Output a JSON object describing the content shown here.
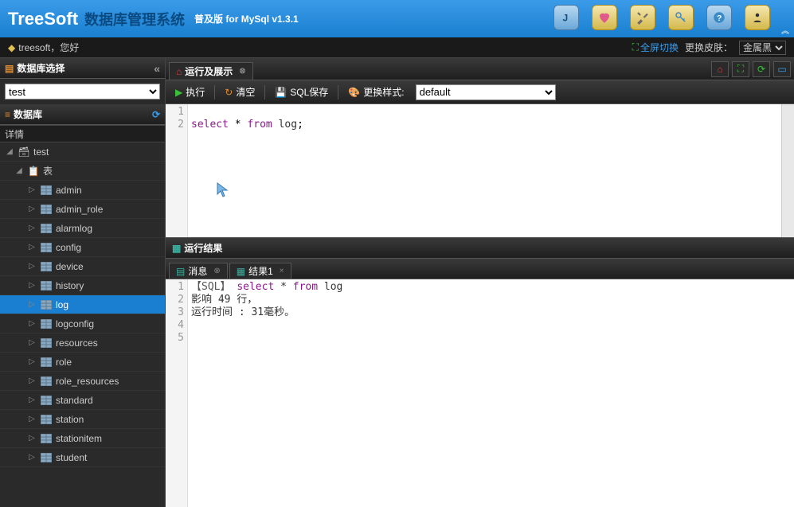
{
  "header": {
    "brand": "TreeSoft",
    "title": "数据库管理系统",
    "version": "普及版 for MySql v1.3.1"
  },
  "subheader": {
    "greeting": "treesoft，您好",
    "fullscreen": "全屏切换",
    "skin_label": "更换皮肤：",
    "skin_value": "金属黑"
  },
  "sidebar": {
    "select_panel": "数据库选择",
    "db_value": "test",
    "db_panel": "数据库",
    "detail_label": "详情",
    "root": "test",
    "tables_label": "表",
    "tables": [
      "admin",
      "admin_role",
      "alarmlog",
      "config",
      "device",
      "history",
      "log",
      "logconfig",
      "resources",
      "role",
      "role_resources",
      "standard",
      "station",
      "stationitem",
      "student"
    ],
    "selected_table": "log"
  },
  "main": {
    "tab_label": "运行及展示",
    "toolbar": {
      "run": "执行",
      "clear": "清空",
      "save": "SQL保存",
      "style": "更换样式:",
      "style_value": "default"
    },
    "editor": {
      "lines": [
        "1",
        "2"
      ],
      "content_html": "<span class='kw'>select</span> * <span class='kw'>from</span> <span class='ident'>log</span>;"
    },
    "results": {
      "header": "运行结果",
      "tabs": {
        "msg": "消息",
        "res1": "结果1"
      },
      "lines": [
        "1",
        "2",
        "3",
        "4",
        "5"
      ],
      "row1_prefix": "【SQL】",
      "row1_sql_html": "<span class='rkw'>select</span> * <span class='rkw'>from</span> log",
      "row2": "影响 49 行，",
      "row3": "运行时间 : 31毫秒。"
    }
  }
}
